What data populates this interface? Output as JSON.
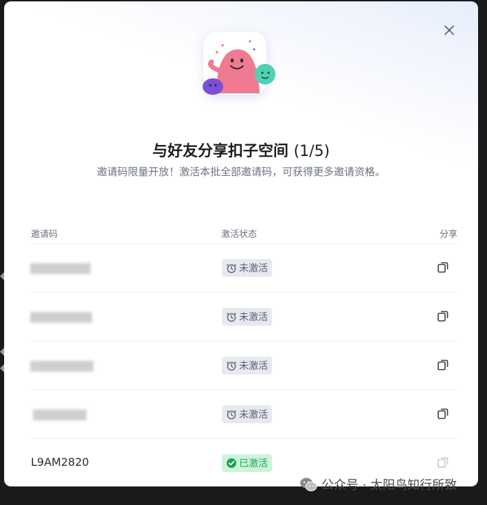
{
  "dialog": {
    "title": "与好友分享扣子空间",
    "count": "(1/5)",
    "subtitle": "邀请码限量开放！激活本批全部邀请码，可获得更多邀请资格。",
    "close_icon": "close-icon",
    "hero_image": "mascot-illustration"
  },
  "table": {
    "headers": {
      "code": "邀请码",
      "status": "激活状态",
      "share": "分享"
    },
    "rows": [
      {
        "code": "",
        "status": "未激活",
        "state": "pending"
      },
      {
        "code": "",
        "status": "未激活",
        "state": "pending"
      },
      {
        "code": "",
        "status": "未激活",
        "state": "pending"
      },
      {
        "code": "",
        "status": "未激活",
        "state": "pending"
      },
      {
        "code": "L9AM2820",
        "status": "已激活",
        "state": "done"
      }
    ]
  },
  "watermark": {
    "text": "公众号 · 太阳鸟知行所致",
    "icon": "wechat-icon"
  },
  "colors": {
    "pending_badge_bg": "#e7e9ef",
    "done_badge_bg": "#cdf4da",
    "done_text": "#1ea35a"
  }
}
